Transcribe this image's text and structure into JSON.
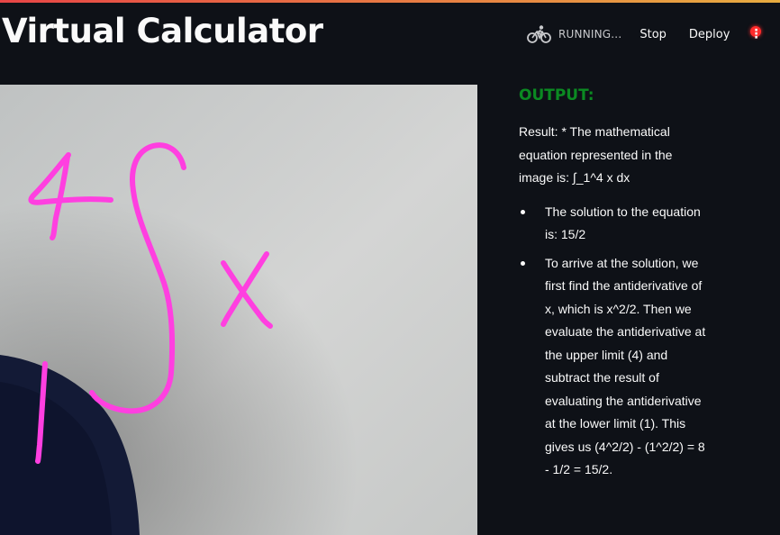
{
  "app": {
    "title": "Virtual Calculator"
  },
  "toolbar": {
    "status_label": "RUNNING...",
    "stop_label": "Stop",
    "deploy_label": "Deploy",
    "menu_icon": "kebab-menu-icon",
    "status_icon": "running-bicycle-icon"
  },
  "output": {
    "heading": "OUTPUT:",
    "result_text": "Result: * The mathematical equation represented in the image is: ∫_1^4 x dx",
    "bullets": [
      "The solution to the equation is: 15/2",
      "To arrive at the solution, we first find the antiderivative of x, which is x^2/2. Then we evaluate the antiderivative at the upper limit (4) and subtract the result of evaluating the antiderivative at the lower limit (1). This gives us (4^2/2) - (1^2/2) = 8 - 1/2 = 15/2."
    ]
  },
  "webcam": {
    "drawn_strokes_color": "#ff3fe0",
    "background_color": "#c9cbcb",
    "person_color": "#121a3a"
  },
  "colors": {
    "background": "#0e1117",
    "heading_green": "#0b8a22",
    "accent_red": "#ff2b2b"
  }
}
